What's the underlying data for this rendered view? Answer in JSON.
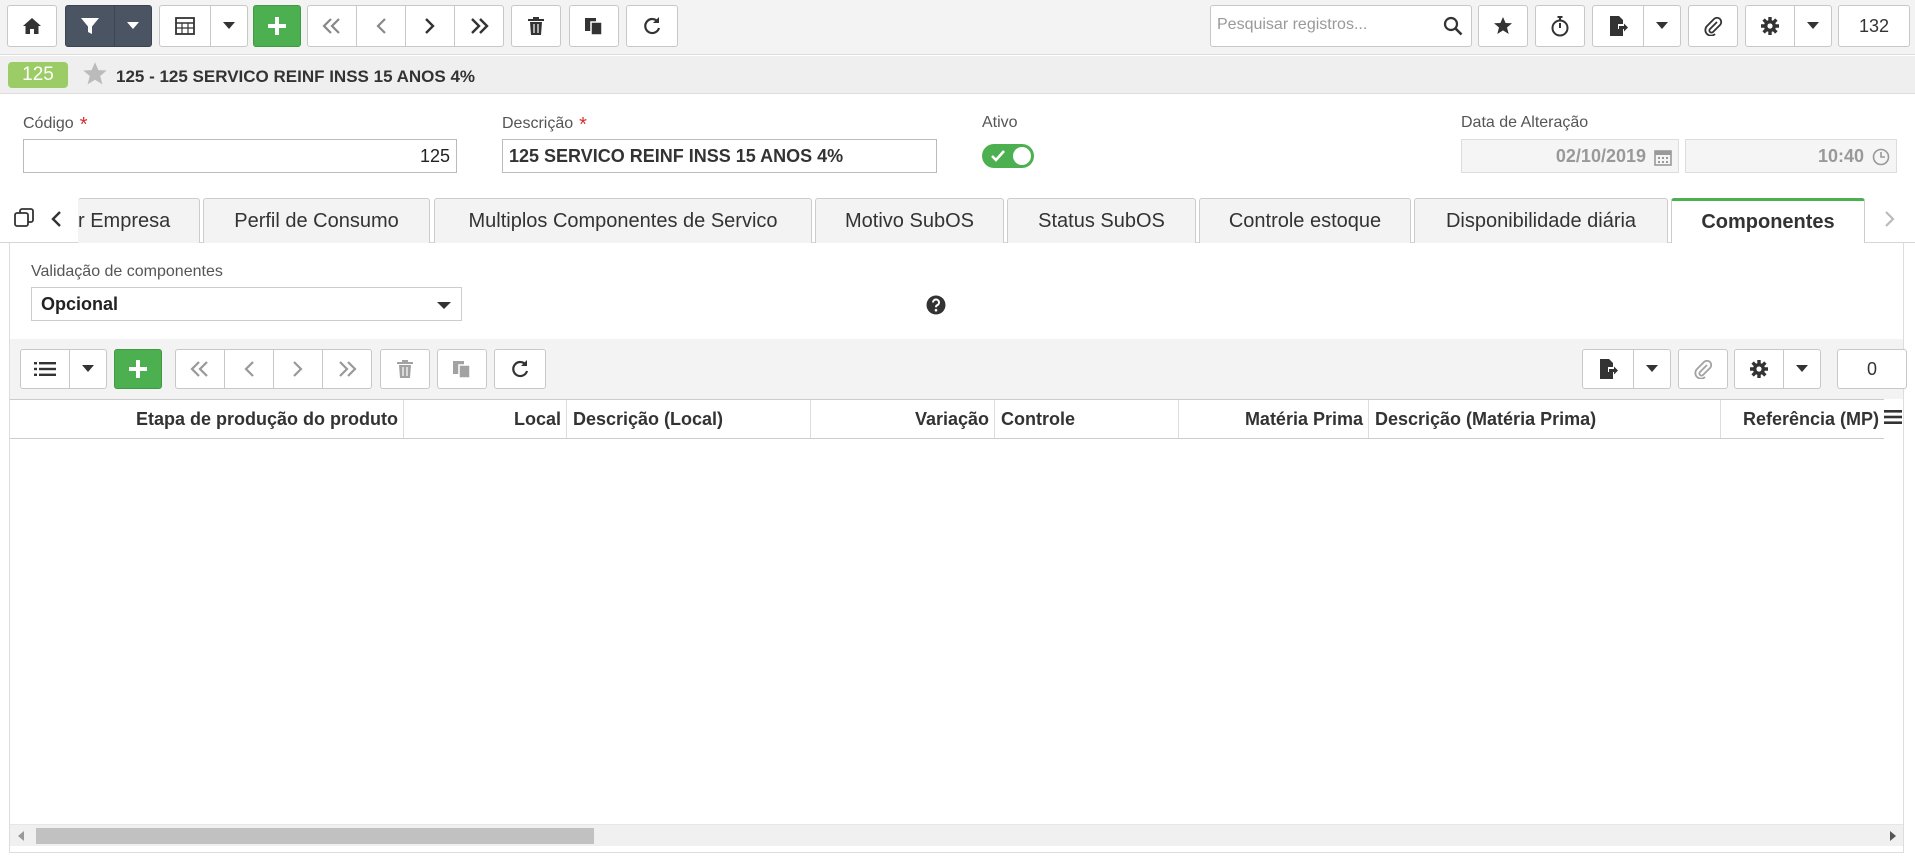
{
  "toolbar": {
    "search_placeholder": "Pesquisar registros...",
    "record_count": "132"
  },
  "record": {
    "badge": "125",
    "title": "125 - 125 SERVICO REINF INSS 15 ANOS 4%"
  },
  "form": {
    "codigo_label": "Código",
    "codigo_value": "125",
    "descricao_label": "Descrição",
    "descricao_value": "125 SERVICO REINF INSS 15 ANOS 4%",
    "ativo_label": "Ativo",
    "ativo_value": true,
    "data_label": "Data de Alteração",
    "data_date": "02/10/2019",
    "data_time": "10:40",
    "required_mark": "*"
  },
  "tabs": [
    {
      "label": "r Empresa"
    },
    {
      "label": "Perfil de Consumo"
    },
    {
      "label": "Multiplos Componentes de Servico"
    },
    {
      "label": "Motivo SubOS"
    },
    {
      "label": "Status SubOS"
    },
    {
      "label": "Controle estoque"
    },
    {
      "label": "Disponibilidade diária"
    },
    {
      "label": "Componentes",
      "active": true
    }
  ],
  "panel": {
    "validacao_label": "Validação de componentes",
    "validacao_value": "Opcional"
  },
  "grid": {
    "count": "0",
    "columns": [
      {
        "label": "Etapa de produção do produto"
      },
      {
        "label": "Local"
      },
      {
        "label": "Descrição (Local)"
      },
      {
        "label": "Variação"
      },
      {
        "label": "Controle"
      },
      {
        "label": "Matéria Prima"
      },
      {
        "label": "Descrição (Matéria Prima)"
      },
      {
        "label": "Referência (MP)"
      }
    ],
    "rows": []
  },
  "colors": {
    "accent_green": "#4caf50",
    "badge_green": "#9ccc65",
    "dark_button": "#4b5462",
    "required_red": "#d32f2f"
  }
}
